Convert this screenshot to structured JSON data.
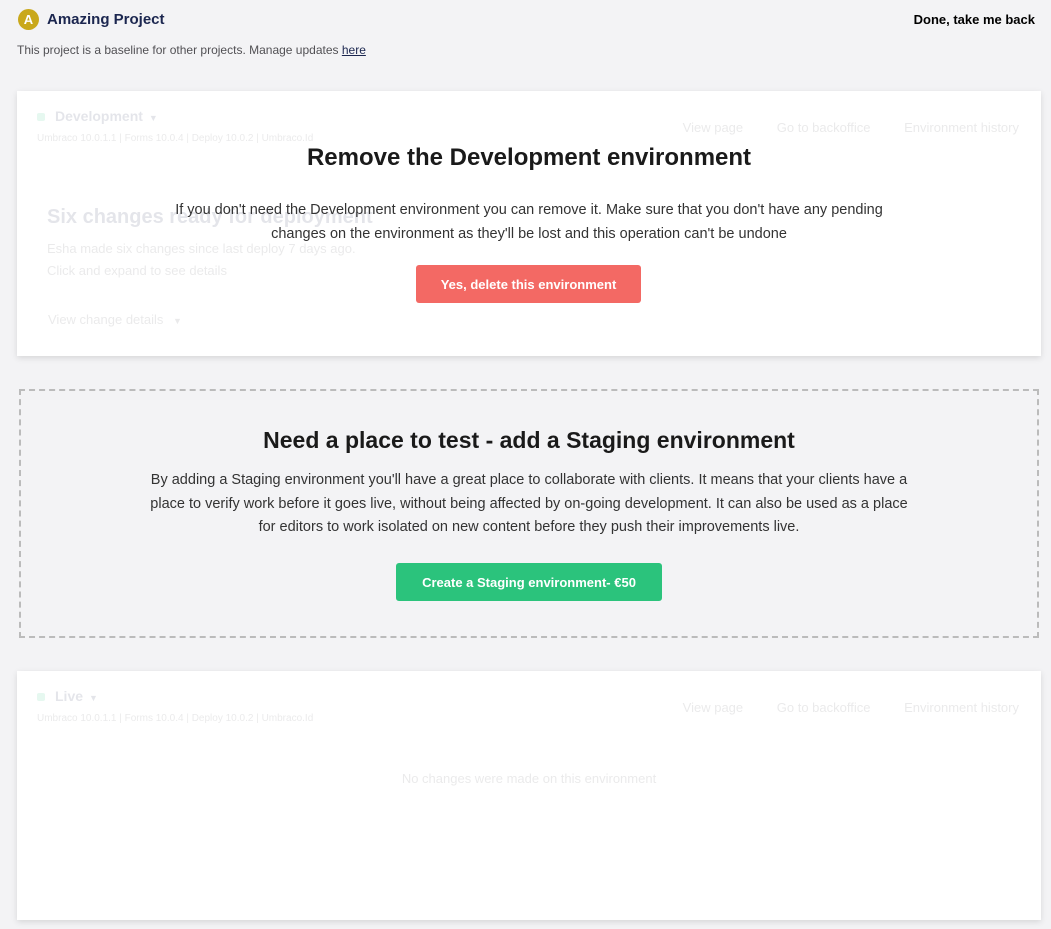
{
  "header": {
    "badge_letter": "A",
    "project_name": "Amazing Project",
    "done_label": "Done, take me back",
    "baseline_text": "This project is a baseline for other projects. Manage updates ",
    "baseline_link": "here"
  },
  "development": {
    "name": "Development",
    "versions": "Umbraco 10.0.1.1  |  Forms 10.0.4  |  Deploy 10.0.2  |  Umbraco.Id",
    "actions": {
      "view_page": "View page",
      "backoffice": "Go to backoffice",
      "history": "Environment history"
    },
    "changes_title": "Six changes ready for deployment",
    "changes_line1": "Esha made six changes since last deploy 7 days ago.",
    "changes_line2": "Click and expand to see details",
    "changes_link": "View change details",
    "remove": {
      "title": "Remove the Development environment",
      "description": "If you don't need the Development environment you can remove it. Make sure that you don't have any pending changes on the environment as they'll be lost and this operation can't be undone",
      "button": "Yes, delete this environment"
    }
  },
  "staging": {
    "title": "Need a place to test - add a Staging environment",
    "description": "By adding a Staging environment you'll have a great place to collaborate with clients. It means that your clients have a place to verify work before it goes live, without being affected by on-going development. It can also be used as a place for editors to work isolated on new content before they push their improvements live.",
    "button": "Create a Staging environment- €50"
  },
  "live": {
    "name": "Live",
    "versions": "Umbraco 10.0.1.1  |  Forms 10.0.4  |  Deploy 10.0.2  |  Umbraco.Id",
    "actions": {
      "view_page": "View page",
      "backoffice": "Go to backoffice",
      "history": "Environment history"
    },
    "empty_text": "No changes were made on this environment"
  },
  "colors": {
    "danger": "#f36964",
    "success": "#2bc37c",
    "badge": "#c9a81b",
    "navy": "#1b264f"
  }
}
